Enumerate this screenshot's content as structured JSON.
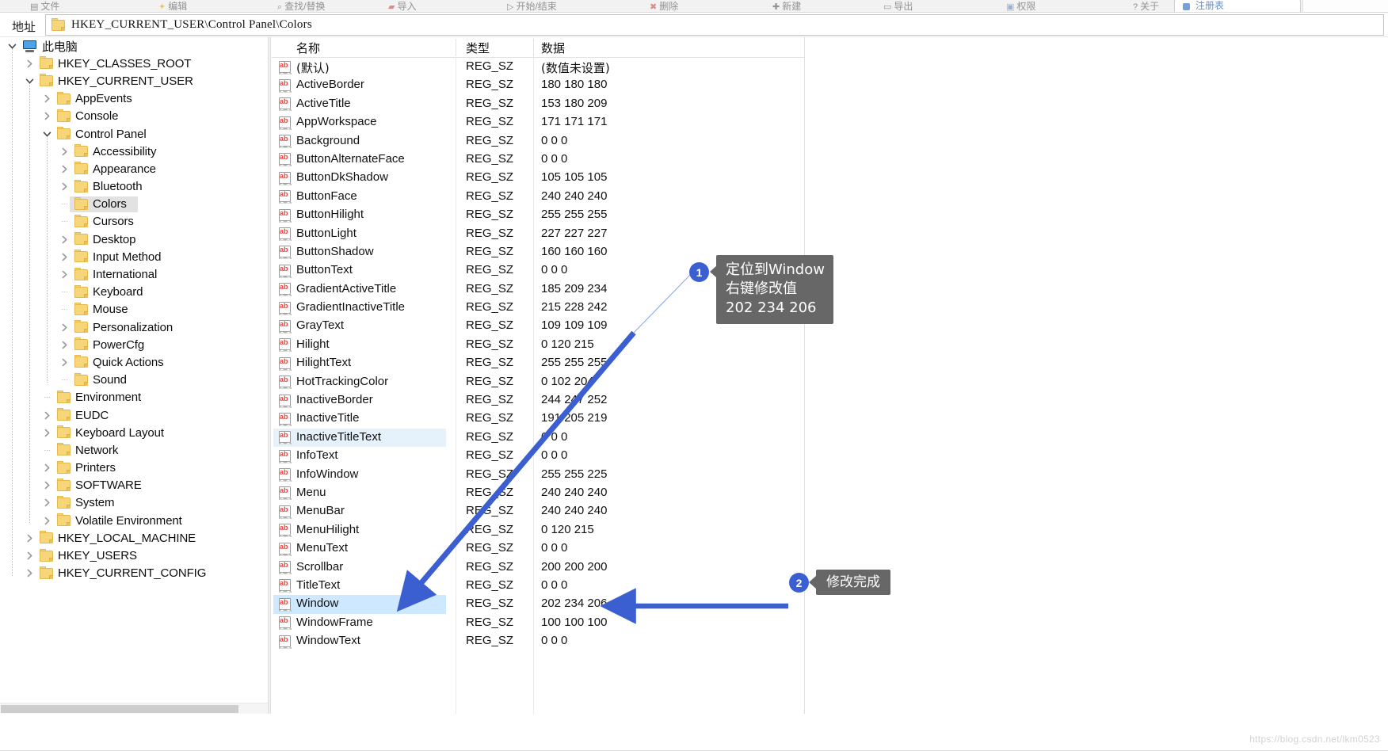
{
  "ribbon": {
    "items": [
      {
        "label": "文件",
        "icon": "file-icon"
      },
      {
        "label": "编辑",
        "icon": "edit-icon"
      },
      {
        "label": "查找/替换",
        "icon": "find-icon"
      },
      {
        "label": "导入",
        "icon": "import-icon"
      },
      {
        "label": "开始/结束",
        "icon": "start-icon"
      },
      {
        "label": "删除",
        "icon": "delete-icon"
      },
      {
        "label": "新建",
        "icon": "new-icon"
      },
      {
        "label": "导出",
        "icon": "export-icon"
      },
      {
        "label": "权限",
        "icon": "permission-icon"
      },
      {
        "label": "关于",
        "icon": "about-icon"
      }
    ],
    "active_tab": "注册表"
  },
  "address": {
    "label": "地址",
    "path": "HKEY_CURRENT_USER\\Control Panel\\Colors",
    "folder_icon": "folder-icon"
  },
  "tree": {
    "root_icon": "computer-icon",
    "nodes": [
      {
        "label": "此电脑",
        "depth": 0,
        "state": "expanded",
        "icon": "computer-icon",
        "selected": false,
        "cn": true
      },
      {
        "label": "HKEY_CLASSES_ROOT",
        "depth": 1,
        "state": "collapsed",
        "icon": "folder-icon",
        "selected": false
      },
      {
        "label": "HKEY_CURRENT_USER",
        "depth": 1,
        "state": "expanded",
        "icon": "folder-icon",
        "selected": false
      },
      {
        "label": "AppEvents",
        "depth": 2,
        "state": "collapsed",
        "icon": "folder-icon",
        "selected": false
      },
      {
        "label": "Console",
        "depth": 2,
        "state": "collapsed",
        "icon": "folder-icon",
        "selected": false
      },
      {
        "label": "Control Panel",
        "depth": 2,
        "state": "expanded",
        "icon": "folder-icon",
        "selected": false
      },
      {
        "label": "Accessibility",
        "depth": 3,
        "state": "collapsed",
        "icon": "folder-icon",
        "selected": false
      },
      {
        "label": "Appearance",
        "depth": 3,
        "state": "collapsed",
        "icon": "folder-icon",
        "selected": false
      },
      {
        "label": "Bluetooth",
        "depth": 3,
        "state": "collapsed",
        "icon": "folder-icon",
        "selected": false
      },
      {
        "label": "Colors",
        "depth": 3,
        "state": "leaf",
        "icon": "folder-icon",
        "selected": true
      },
      {
        "label": "Cursors",
        "depth": 3,
        "state": "leaf",
        "icon": "folder-icon",
        "selected": false
      },
      {
        "label": "Desktop",
        "depth": 3,
        "state": "collapsed",
        "icon": "folder-icon",
        "selected": false
      },
      {
        "label": "Input Method",
        "depth": 3,
        "state": "collapsed",
        "icon": "folder-icon",
        "selected": false
      },
      {
        "label": "International",
        "depth": 3,
        "state": "collapsed",
        "icon": "folder-icon",
        "selected": false
      },
      {
        "label": "Keyboard",
        "depth": 3,
        "state": "leaf",
        "icon": "folder-icon",
        "selected": false
      },
      {
        "label": "Mouse",
        "depth": 3,
        "state": "leaf",
        "icon": "folder-icon",
        "selected": false
      },
      {
        "label": "Personalization",
        "depth": 3,
        "state": "collapsed",
        "icon": "folder-icon",
        "selected": false
      },
      {
        "label": "PowerCfg",
        "depth": 3,
        "state": "collapsed",
        "icon": "folder-icon",
        "selected": false
      },
      {
        "label": "Quick Actions",
        "depth": 3,
        "state": "collapsed",
        "icon": "folder-icon",
        "selected": false
      },
      {
        "label": "Sound",
        "depth": 3,
        "state": "leaf",
        "icon": "folder-icon",
        "selected": false
      },
      {
        "label": "Environment",
        "depth": 2,
        "state": "leaf",
        "icon": "folder-icon",
        "selected": false
      },
      {
        "label": "EUDC",
        "depth": 2,
        "state": "collapsed",
        "icon": "folder-icon",
        "selected": false
      },
      {
        "label": "Keyboard Layout",
        "depth": 2,
        "state": "collapsed",
        "icon": "folder-icon",
        "selected": false
      },
      {
        "label": "Network",
        "depth": 2,
        "state": "leaf",
        "icon": "folder-icon",
        "selected": false
      },
      {
        "label": "Printers",
        "depth": 2,
        "state": "collapsed",
        "icon": "folder-icon",
        "selected": false
      },
      {
        "label": "SOFTWARE",
        "depth": 2,
        "state": "collapsed",
        "icon": "folder-icon",
        "selected": false
      },
      {
        "label": "System",
        "depth": 2,
        "state": "collapsed",
        "icon": "folder-icon",
        "selected": false
      },
      {
        "label": "Volatile Environment",
        "depth": 2,
        "state": "collapsed",
        "icon": "folder-icon",
        "selected": false
      },
      {
        "label": "HKEY_LOCAL_MACHINE",
        "depth": 1,
        "state": "collapsed",
        "icon": "folder-icon",
        "selected": false
      },
      {
        "label": "HKEY_USERS",
        "depth": 1,
        "state": "collapsed",
        "icon": "folder-icon",
        "selected": false
      },
      {
        "label": "HKEY_CURRENT_CONFIG",
        "depth": 1,
        "state": "collapsed",
        "icon": "folder-icon",
        "selected": false
      }
    ]
  },
  "list": {
    "columns": [
      "名称",
      "类型",
      "数据"
    ],
    "rows": [
      {
        "name": "(默认)",
        "type": "REG_SZ",
        "data": "(数值未设置)",
        "state": "normal",
        "cn": true
      },
      {
        "name": "ActiveBorder",
        "type": "REG_SZ",
        "data": "180 180 180",
        "state": "normal"
      },
      {
        "name": "ActiveTitle",
        "type": "REG_SZ",
        "data": "153 180 209",
        "state": "normal"
      },
      {
        "name": "AppWorkspace",
        "type": "REG_SZ",
        "data": "171 171 171",
        "state": "normal"
      },
      {
        "name": "Background",
        "type": "REG_SZ",
        "data": "0 0 0",
        "state": "normal"
      },
      {
        "name": "ButtonAlternateFace",
        "type": "REG_SZ",
        "data": "0 0 0",
        "state": "normal"
      },
      {
        "name": "ButtonDkShadow",
        "type": "REG_SZ",
        "data": "105 105 105",
        "state": "normal"
      },
      {
        "name": "ButtonFace",
        "type": "REG_SZ",
        "data": "240 240 240",
        "state": "normal"
      },
      {
        "name": "ButtonHilight",
        "type": "REG_SZ",
        "data": "255 255 255",
        "state": "normal"
      },
      {
        "name": "ButtonLight",
        "type": "REG_SZ",
        "data": "227 227 227",
        "state": "normal"
      },
      {
        "name": "ButtonShadow",
        "type": "REG_SZ",
        "data": "160 160 160",
        "state": "normal"
      },
      {
        "name": "ButtonText",
        "type": "REG_SZ",
        "data": "0 0 0",
        "state": "normal"
      },
      {
        "name": "GradientActiveTitle",
        "type": "REG_SZ",
        "data": "185 209 234",
        "state": "normal"
      },
      {
        "name": "GradientInactiveTitle",
        "type": "REG_SZ",
        "data": "215 228 242",
        "state": "normal"
      },
      {
        "name": "GrayText",
        "type": "REG_SZ",
        "data": "109 109 109",
        "state": "normal"
      },
      {
        "name": "Hilight",
        "type": "REG_SZ",
        "data": "0 120 215",
        "state": "normal"
      },
      {
        "name": "HilightText",
        "type": "REG_SZ",
        "data": "255 255 255",
        "state": "normal"
      },
      {
        "name": "HotTrackingColor",
        "type": "REG_SZ",
        "data": "0 102 204",
        "state": "normal"
      },
      {
        "name": "InactiveBorder",
        "type": "REG_SZ",
        "data": "244 247 252",
        "state": "normal"
      },
      {
        "name": "InactiveTitle",
        "type": "REG_SZ",
        "data": "191 205 219",
        "state": "normal"
      },
      {
        "name": "InactiveTitleText",
        "type": "REG_SZ",
        "data": "0 0 0",
        "state": "highlighted"
      },
      {
        "name": "InfoText",
        "type": "REG_SZ",
        "data": "0 0 0",
        "state": "normal"
      },
      {
        "name": "InfoWindow",
        "type": "REG_SZ",
        "data": "255 255 225",
        "state": "normal"
      },
      {
        "name": "Menu",
        "type": "REG_SZ",
        "data": "240 240 240",
        "state": "normal"
      },
      {
        "name": "MenuBar",
        "type": "REG_SZ",
        "data": "240 240 240",
        "state": "normal"
      },
      {
        "name": "MenuHilight",
        "type": "REG_SZ",
        "data": "0 120 215",
        "state": "normal"
      },
      {
        "name": "MenuText",
        "type": "REG_SZ",
        "data": "0 0 0",
        "state": "normal"
      },
      {
        "name": "Scrollbar",
        "type": "REG_SZ",
        "data": "200 200 200",
        "state": "normal"
      },
      {
        "name": "TitleText",
        "type": "REG_SZ",
        "data": "0 0 0",
        "state": "normal"
      },
      {
        "name": "Window",
        "type": "REG_SZ",
        "data": "202 234 206",
        "state": "selected"
      },
      {
        "name": "WindowFrame",
        "type": "REG_SZ",
        "data": "100 100 100",
        "state": "normal"
      },
      {
        "name": "WindowText",
        "type": "REG_SZ",
        "data": "0 0 0",
        "state": "normal"
      }
    ]
  },
  "annotations": {
    "accent_color": "#3b5fd0",
    "callout_bg": "#676767",
    "items": [
      {
        "number": "1",
        "text": "定位到Window\n右键修改值\n202 234 206"
      },
      {
        "number": "2",
        "text": "修改完成"
      }
    ]
  },
  "watermark": "https://blog.csdn.net/lkm0523"
}
